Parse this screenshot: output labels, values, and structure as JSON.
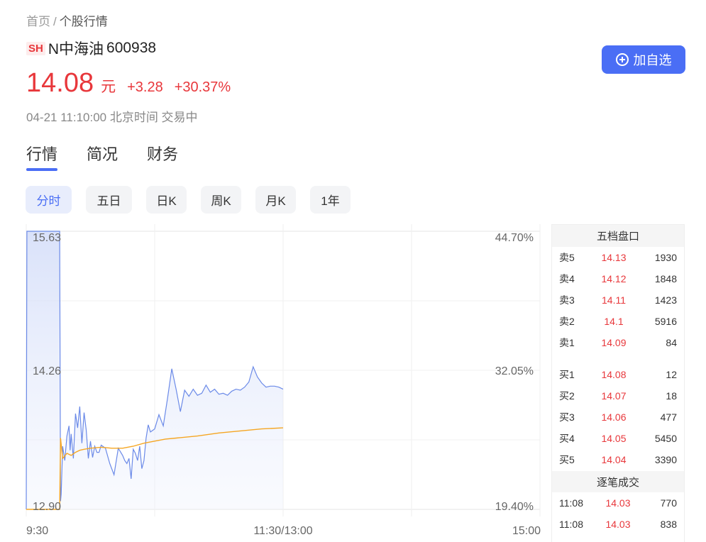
{
  "breadcrumb": {
    "home": "首页",
    "separator": "/",
    "current": "个股行情"
  },
  "stock": {
    "exchange": "SH",
    "name": "N中海油",
    "code": "600938",
    "price": "14.08",
    "unit": "元",
    "change": "+3.28",
    "change_pct": "+30.37%",
    "time_status": "04-21 11:10:00 北京时间 交易中"
  },
  "actions": {
    "add_favorite": "加自选"
  },
  "tabs": [
    {
      "label": "行情",
      "active": true
    },
    {
      "label": "简况",
      "active": false
    },
    {
      "label": "财务",
      "active": false
    }
  ],
  "periods": [
    {
      "label": "分时",
      "active": true
    },
    {
      "label": "五日",
      "active": false
    },
    {
      "label": "日K",
      "active": false
    },
    {
      "label": "周K",
      "active": false
    },
    {
      "label": "月K",
      "active": false
    },
    {
      "label": "1年",
      "active": false
    }
  ],
  "colors": {
    "accent": "#4a6ef5",
    "up": "#e8373b",
    "price_line": "#6b8ae8",
    "avg_line": "#f5a623"
  },
  "chart_data": {
    "type": "line",
    "y_ticks": [
      "15.63",
      "14.26",
      "12.90"
    ],
    "y_ticks_right": [
      "44.70%",
      "32.05%",
      "19.40%"
    ],
    "x_ticks": [
      "9:30",
      "11:30/13:00",
      "15:00"
    ],
    "ylim": [
      12.9,
      15.63
    ],
    "x_range_minutes": [
      0,
      240
    ],
    "grid": true,
    "series": [
      {
        "key": "price",
        "x": [
          0,
          0.3,
          1,
          9,
          15.6,
          16,
          16.3,
          17,
          18,
          19,
          20,
          20.5,
          21,
          22,
          23,
          24,
          25,
          26,
          27,
          28,
          29,
          30,
          31,
          32,
          33,
          34,
          35,
          37,
          39,
          41,
          43,
          45,
          46,
          47,
          48,
          49,
          50,
          51,
          52,
          53,
          54,
          55,
          56,
          57,
          58,
          60,
          62,
          64,
          66,
          68,
          70,
          72,
          74,
          76,
          78,
          80,
          82,
          84,
          86,
          88,
          90,
          92,
          94,
          96,
          98,
          100,
          102,
          104,
          106,
          108,
          110,
          112,
          114,
          116,
          118,
          120
        ],
        "values": [
          12.9,
          15.63,
          15.63,
          15.63,
          15.63,
          12.98,
          13.05,
          13.52,
          13.38,
          13.62,
          13.72,
          13.48,
          13.64,
          13.4,
          13.84,
          13.7,
          13.91,
          13.55,
          13.85,
          13.68,
          13.4,
          13.57,
          13.41,
          13.52,
          13.46,
          13.46,
          13.53,
          13.5,
          13.35,
          13.24,
          13.5,
          13.43,
          13.38,
          13.35,
          13.4,
          13.2,
          13.49,
          13.45,
          13.38,
          13.52,
          13.3,
          13.38,
          13.6,
          13.73,
          13.66,
          13.69,
          13.83,
          13.72,
          13.99,
          14.28,
          14.08,
          13.86,
          14.07,
          14.01,
          14.08,
          14.02,
          14.04,
          14.12,
          14.05,
          14.08,
          14.03,
          14.04,
          14.02,
          14.06,
          14.08,
          14.07,
          14.1,
          14.15,
          14.3,
          14.2,
          14.14,
          14.1,
          14.11,
          14.11,
          14.1,
          14.08
        ]
      },
      {
        "key": "average",
        "x": [
          0,
          15.6,
          16,
          17,
          19,
          21,
          23,
          25,
          27,
          30,
          35,
          40,
          45,
          50,
          55,
          60,
          65,
          70,
          80,
          90,
          100,
          110,
          120
        ],
        "values": [
          12.9,
          12.9,
          13.6,
          13.4,
          13.45,
          13.43,
          13.46,
          13.48,
          13.49,
          13.5,
          13.51,
          13.5,
          13.5,
          13.52,
          13.55,
          13.57,
          13.59,
          13.6,
          13.62,
          13.65,
          13.67,
          13.69,
          13.7
        ]
      }
    ]
  },
  "order_book": {
    "title": "五档盘口",
    "asks": [
      {
        "label": "卖5",
        "price": "14.13",
        "volume": "1930"
      },
      {
        "label": "卖4",
        "price": "14.12",
        "volume": "1848"
      },
      {
        "label": "卖3",
        "price": "14.11",
        "volume": "1423"
      },
      {
        "label": "卖2",
        "price": "14.1",
        "volume": "5916"
      },
      {
        "label": "卖1",
        "price": "14.09",
        "volume": "84"
      }
    ],
    "bids": [
      {
        "label": "买1",
        "price": "14.08",
        "volume": "12"
      },
      {
        "label": "买2",
        "price": "14.07",
        "volume": "18"
      },
      {
        "label": "买3",
        "price": "14.06",
        "volume": "477"
      },
      {
        "label": "买4",
        "price": "14.05",
        "volume": "5450"
      },
      {
        "label": "买5",
        "price": "14.04",
        "volume": "3390"
      }
    ]
  },
  "trades": {
    "title": "逐笔成交",
    "rows": [
      {
        "time": "11:08",
        "price": "14.03",
        "volume": "770"
      },
      {
        "time": "11:08",
        "price": "14.03",
        "volume": "838"
      }
    ]
  }
}
